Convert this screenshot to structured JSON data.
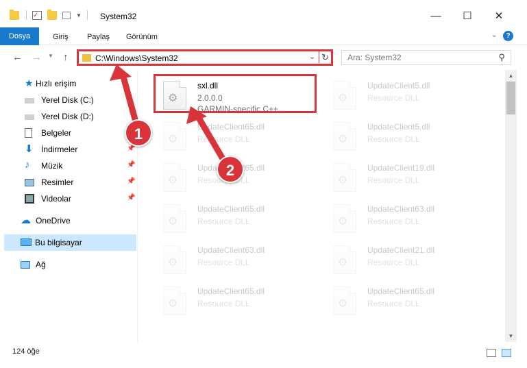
{
  "window": {
    "title": "System32",
    "minimize": "—",
    "maximize": "☐",
    "close": "✕"
  },
  "ribbon": {
    "tabs": [
      "Dosya",
      "Giriş",
      "Paylaş",
      "Görünüm"
    ],
    "help": "?"
  },
  "nav": {
    "back": "←",
    "forward": "→",
    "up": "↑",
    "address": "C:\\Windows\\System32",
    "refresh": "↻",
    "search_placeholder": "Ara: System32"
  },
  "sidebar": {
    "items": [
      {
        "label": "Hızlı erişim",
        "icon": "star-icon",
        "pinned": false
      },
      {
        "label": "Yerel Disk (C:)",
        "icon": "drive-icon",
        "pinned": false
      },
      {
        "label": "Yerel Disk (D:)",
        "icon": "drive-icon",
        "pinned": false
      },
      {
        "label": "Belgeler",
        "icon": "documents-icon",
        "pinned": true
      },
      {
        "label": "İndirmeler",
        "icon": "downloads-icon",
        "pinned": true
      },
      {
        "label": "Müzik",
        "icon": "music-icon",
        "pinned": true
      },
      {
        "label": "Resimler",
        "icon": "pictures-icon",
        "pinned": true
      },
      {
        "label": "Videolar",
        "icon": "videos-icon",
        "pinned": true
      },
      {
        "label": "OneDrive",
        "icon": "cloud-icon",
        "pinned": false
      },
      {
        "label": "Bu bilgisayar",
        "icon": "computer-icon",
        "pinned": false,
        "selected": true
      },
      {
        "label": "Ağ",
        "icon": "network-icon",
        "pinned": false
      }
    ],
    "pin_glyph": "📌"
  },
  "files": [
    {
      "name": "sxl.dll",
      "line2": "2.0.0.0",
      "line3": "GARMIN-specific C++...",
      "highlighted": true
    },
    {
      "name": "UpdateClient5.dll",
      "line2": "Resource DLL",
      "line3": ""
    },
    {
      "name": "UpdateClient65.dll",
      "line2": "Resource DLL",
      "line3": ""
    },
    {
      "name": "UpdateClient5.dll",
      "line2": "Resource DLL",
      "line3": ""
    },
    {
      "name": "UpdateClient65.dll",
      "line2": "Resource DLL",
      "line3": ""
    },
    {
      "name": "UpdateClient19.dll",
      "line2": "Resource DLL",
      "line3": ""
    },
    {
      "name": "UpdateClient65.dll",
      "line2": "Resource DLL",
      "line3": ""
    },
    {
      "name": "UpdateClient63.dll",
      "line2": "Resource DLL",
      "line3": ""
    },
    {
      "name": "UpdateClient63.dll",
      "line2": "Resource DLL",
      "line3": ""
    },
    {
      "name": "UpdateClient21.dll",
      "line2": "Resource DLL",
      "line3": ""
    },
    {
      "name": "UpdateClient65.dll",
      "line2": "Resource DLL",
      "line3": ""
    },
    {
      "name": "UpdateClient65.dll",
      "line2": "Resource DLL",
      "line3": ""
    }
  ],
  "status": {
    "count": "124 öğe"
  },
  "annotations": {
    "step1": "1",
    "step2": "2",
    "color": "#d9343a"
  }
}
